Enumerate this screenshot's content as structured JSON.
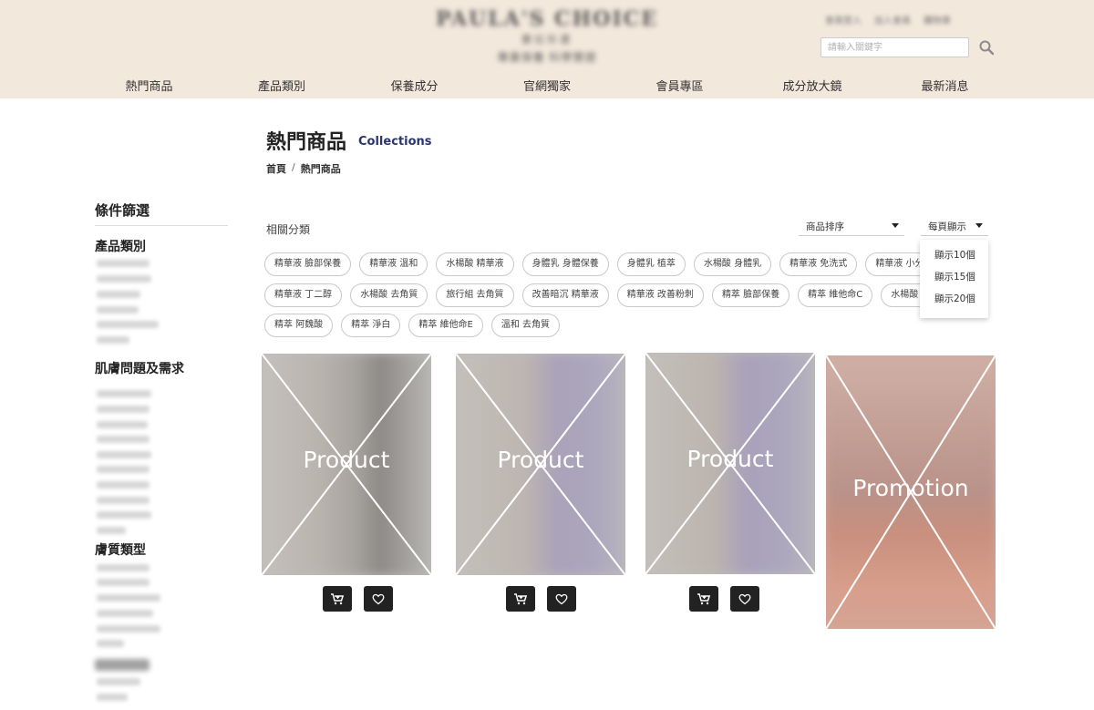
{
  "header": {
    "logo_text": "PAULA'S CHOICE",
    "logo_sub": "寶拉珍選",
    "logo_tagline": "專業保養 科學實證",
    "top_links": [
      "會員登入",
      "加入會員",
      "購物車"
    ],
    "search_placeholder": "請輸入關鍵字"
  },
  "nav": {
    "items": [
      "熱門商品",
      "產品類別",
      "保養成分",
      "官網獨家",
      "會員專區",
      "成分放大鏡",
      "最新消息"
    ]
  },
  "page": {
    "title": "熱門商品",
    "subtitle": "Collections",
    "breadcrumb": [
      "首頁",
      "熱門商品"
    ],
    "breadcrumb_sep": "/"
  },
  "sidebar": {
    "title": "條件篩選",
    "groups": [
      {
        "title": "產品類別"
      },
      {
        "title": "肌膚問題及需求"
      },
      {
        "title": "膚質類型"
      }
    ]
  },
  "categories": {
    "label": "相關分類",
    "rows": [
      [
        "精華液 臉部保養",
        "精華液 溫和",
        "水楊酸 精華液",
        "身體乳 身體保養",
        "身體乳 植萃",
        "水楊酸 身體乳",
        "精華液 免洗式",
        "精華液 小分子"
      ],
      [
        "精華液 丁二醇",
        "水楊酸 去角質",
        "旅行組 去角質",
        "改善暗沉 精華液",
        "精華液 改善粉刺",
        "精萃 臉部保養",
        "精萃 維他命C",
        "水楊酸 溫和"
      ],
      [
        "精萃 阿魏酸",
        "精萃 淨白",
        "精萃 維他命E",
        "溫和 去角質"
      ]
    ]
  },
  "sort": {
    "sort_label": "商品排序",
    "perpage_label": "每頁顯示",
    "perpage_options": [
      "顯示10個",
      "顯示15個",
      "顯示20個"
    ]
  },
  "products": [
    {
      "placeholder": "Product"
    },
    {
      "placeholder": "Product"
    },
    {
      "placeholder": "Product"
    }
  ],
  "promotion": {
    "placeholder": "Promotion"
  },
  "colors": {
    "header_bg": "#f3e8dc",
    "accent_navy": "#2a3570",
    "button_dark": "#222222"
  }
}
